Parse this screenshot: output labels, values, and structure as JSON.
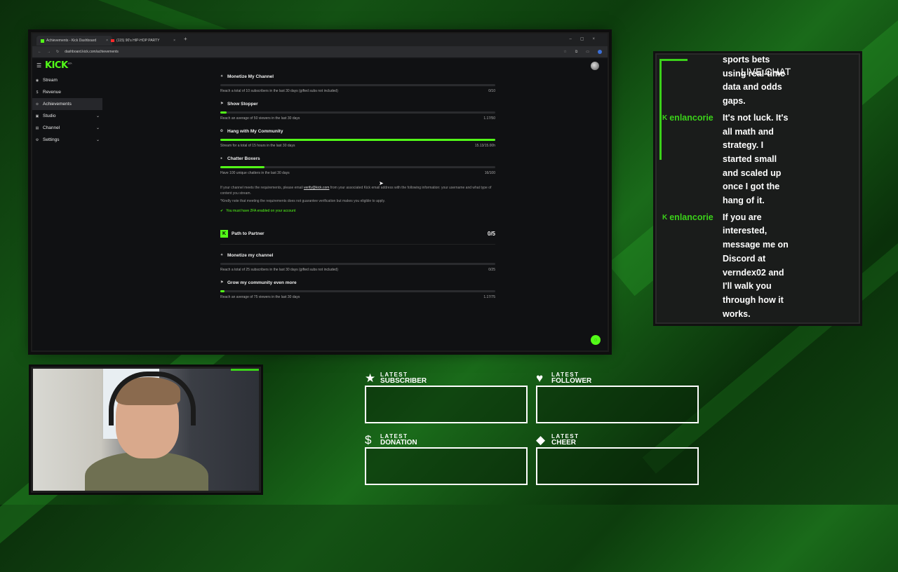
{
  "browser": {
    "tabs": [
      {
        "title": "Achievements - Kick Dashboard",
        "close": "×"
      },
      {
        "title": "(115) 90's HIP-HOP PARTY",
        "close": "×"
      }
    ],
    "new_tab": "+",
    "window_controls": "–▢×",
    "url": "dashboard.kick.com/achievements",
    "nav": {
      "back": "←",
      "forward": "→",
      "reload": "↻"
    }
  },
  "app": {
    "logo": "KICK",
    "logo_badge": "BETA",
    "sidebar": {
      "items": [
        {
          "label": "Stream",
          "icon": "broadcast-icon"
        },
        {
          "label": "Revenue",
          "icon": "dollar-icon"
        },
        {
          "label": "Achievements",
          "icon": "trophy-icon"
        },
        {
          "label": "Studio",
          "icon": "studio-icon",
          "chevron": "⌄"
        },
        {
          "label": "Channel",
          "icon": "channel-icon",
          "chevron": "⌄"
        },
        {
          "label": "Settings",
          "icon": "gear-icon",
          "chevron": "⌄"
        }
      ]
    },
    "verification": {
      "achievements": [
        {
          "title": "Monetize My Channel",
          "desc": "Reach a total of 10 subscribers in the last 30 days (gifted subs not included)",
          "value": "0/10",
          "progress": 0.0
        },
        {
          "title": "Show Stopper",
          "desc": "Reach an average of 50 viewers in the last 30 days",
          "value": "1.17/50",
          "progress": 0.023
        },
        {
          "title": "Hang with My Community",
          "desc": "Stream for a total of 15 hours in the last 30 days",
          "value": "15.13/15.00h",
          "progress": 1.0
        },
        {
          "title": "Chatter Boxers",
          "desc": "Have 100 unique chatters in the last 30 days",
          "value": "16/100",
          "progress": 0.16
        }
      ],
      "note_prefix": "If your channel meets the requirements, please email",
      "note_email": "verify@kick.com",
      "note_suffix": "from your associated Kick email address with the following information: your username and what type of content you stream.",
      "note2": "*Kindly note that meeting the requirements does not guarantee verification but makes you eligible to apply.",
      "twofa": "You must have 2FA enabled on your account"
    },
    "path_to_partner": {
      "title": "Path to Partner",
      "count": "0/5",
      "achievements": [
        {
          "title": "Monetize my channel",
          "desc": "Reach a total of 25 subscribers in the last 30 days (gifted subs not included)",
          "value": "0/25",
          "progress": 0.0
        },
        {
          "title": "Grow my community even more",
          "desc": "Reach an average of 75 viewers in the last 30 days",
          "value": "1.17/75",
          "progress": 0.016
        }
      ]
    }
  },
  "chat": {
    "header": "LIVE CHAT",
    "messages": [
      {
        "user": "",
        "text": "sports bets using real-time data and odds gaps."
      },
      {
        "user": "enlancorie",
        "text": "It's not luck. It's all math and strategy. I started small and scaled up once I got the hang of it."
      },
      {
        "user": "enlancorie",
        "text": "If you are interested, message me on Discord at verndex02 and I'll walk you through how it works."
      }
    ]
  },
  "widgets": [
    {
      "l1": "LATEST",
      "l2": "SUBSCRIBER",
      "icon": "star-icon"
    },
    {
      "l1": "LATEST",
      "l2": "FOLLOWER",
      "icon": "heart-icon"
    },
    {
      "l1": "LATEST",
      "l2": "DONATION",
      "icon": "dollar-icon"
    },
    {
      "l1": "LATEST",
      "l2": "CHEER",
      "icon": "diamond-icon"
    }
  ],
  "colors": {
    "accent": "#53fc18",
    "chat_accent": "#3bd11a"
  }
}
